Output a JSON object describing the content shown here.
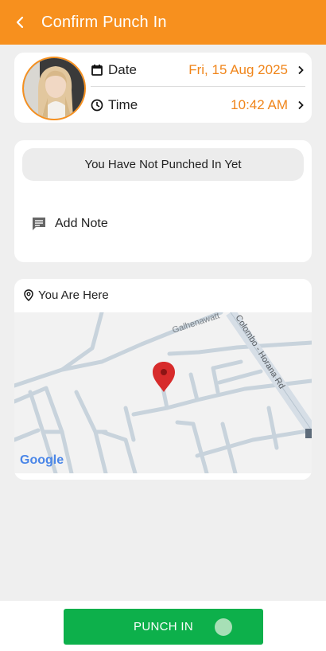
{
  "header": {
    "title": "Confirm Punch In",
    "back_icon": "arrow-left-icon",
    "color": "#f7901e"
  },
  "info": {
    "date_label": "Date",
    "date_value": "Fri, 15 Aug 2025",
    "time_label": "Time",
    "time_value": "10:42 AM",
    "accent": "#f0851a"
  },
  "status": {
    "message": "You Have Not Punched In Yet"
  },
  "note": {
    "label": "Add Note",
    "icon": "note-icon"
  },
  "location": {
    "label": "You Are Here",
    "map_labels": {
      "road1": "Galhenawatt",
      "road2": "Colombo - Horana Rd",
      "brand": "Google"
    }
  },
  "action": {
    "label": "PUNCH IN",
    "color": "#0db04b"
  }
}
